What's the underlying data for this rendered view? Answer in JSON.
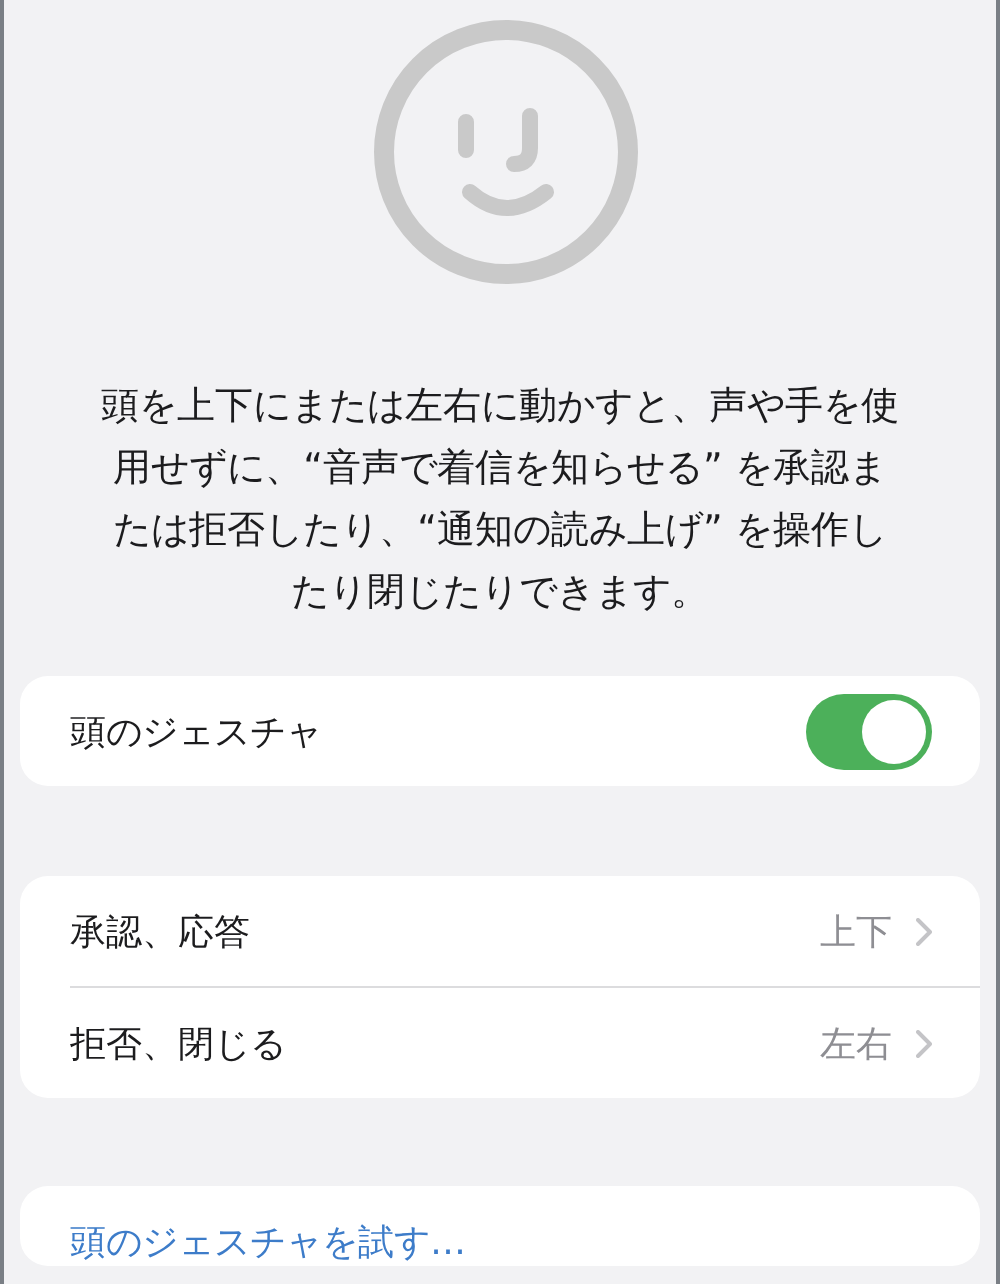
{
  "description": "頭を上下にまたは左右に動かすと、声や手を使用せずに、“音声で着信を知らせる” を承認または拒否したり、“通知の読み上げ” を操作したり閉じたりできます。",
  "toggle_row": {
    "label": "頭のジェスチャ",
    "on": true
  },
  "gesture_rows": [
    {
      "label": "承認、応答",
      "value": "上下"
    },
    {
      "label": "拒否、閉じる",
      "value": "左右"
    }
  ],
  "try_link": "頭のジェスチャを試す…"
}
